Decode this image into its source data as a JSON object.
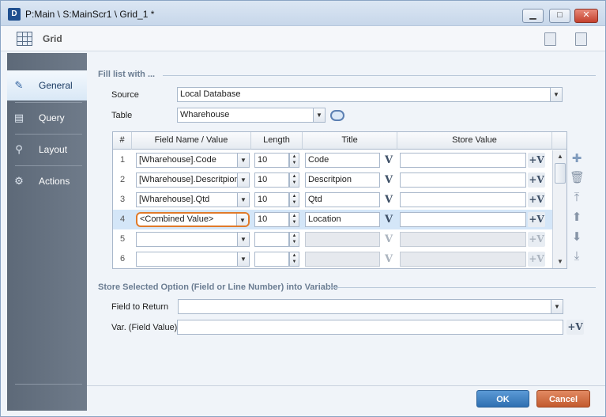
{
  "window": {
    "title": "P:Main \\ S:MainScr1 \\ Grid_1 *",
    "app_icon_text": "D"
  },
  "header": {
    "title": "Grid"
  },
  "sidebar": {
    "items": [
      {
        "label": "General",
        "icon": "pencil-icon",
        "active": true
      },
      {
        "label": "Query",
        "icon": "query-icon",
        "active": false
      },
      {
        "label": "Layout",
        "icon": "layout-icon",
        "active": false
      },
      {
        "label": "Actions",
        "icon": "actions-icon",
        "active": false
      }
    ]
  },
  "fill_list": {
    "section_title": "Fill list with ...",
    "source_label": "Source",
    "source_value": "Local Database",
    "table_label": "Table",
    "table_value": "Wharehouse"
  },
  "grid": {
    "columns": [
      "#",
      "Field Name / Value",
      "Length",
      "Title",
      "Store Value"
    ],
    "rows": [
      {
        "num": "1",
        "field": "[Wharehouse].Code",
        "length": "10",
        "title": "Code",
        "store": "",
        "enabled": true,
        "selected": false
      },
      {
        "num": "2",
        "field": "[Wharehouse].Descritpion",
        "length": "10",
        "title": "Descritpion",
        "store": "",
        "enabled": true,
        "selected": false
      },
      {
        "num": "3",
        "field": "[Wharehouse].Qtd",
        "length": "10",
        "title": "Qtd",
        "store": "",
        "enabled": true,
        "selected": false
      },
      {
        "num": "4",
        "field": "<Combined Value>",
        "length": "10",
        "title": "Location",
        "store": "",
        "enabled": true,
        "selected": true
      },
      {
        "num": "5",
        "field": "",
        "length": "",
        "title": "",
        "store": "",
        "enabled": false,
        "selected": false
      },
      {
        "num": "6",
        "field": "",
        "length": "",
        "title": "",
        "store": "",
        "enabled": false,
        "selected": false
      }
    ],
    "var_glyph": "V",
    "plus_var_glyph": "+V"
  },
  "store_selected": {
    "section_title": "Store Selected Option (Field or Line Number) into Variable",
    "field_to_return_label": "Field to Return",
    "field_to_return_value": "",
    "var_label": "Var. (Field Value)",
    "var_value": ""
  },
  "buttons": {
    "ok": "OK",
    "cancel": "Cancel"
  },
  "colors": {
    "accent": "#2f6fb1",
    "cancel": "#c25a2e",
    "sidebar": "#6f7b8a",
    "highlight": "#e07a2a"
  }
}
